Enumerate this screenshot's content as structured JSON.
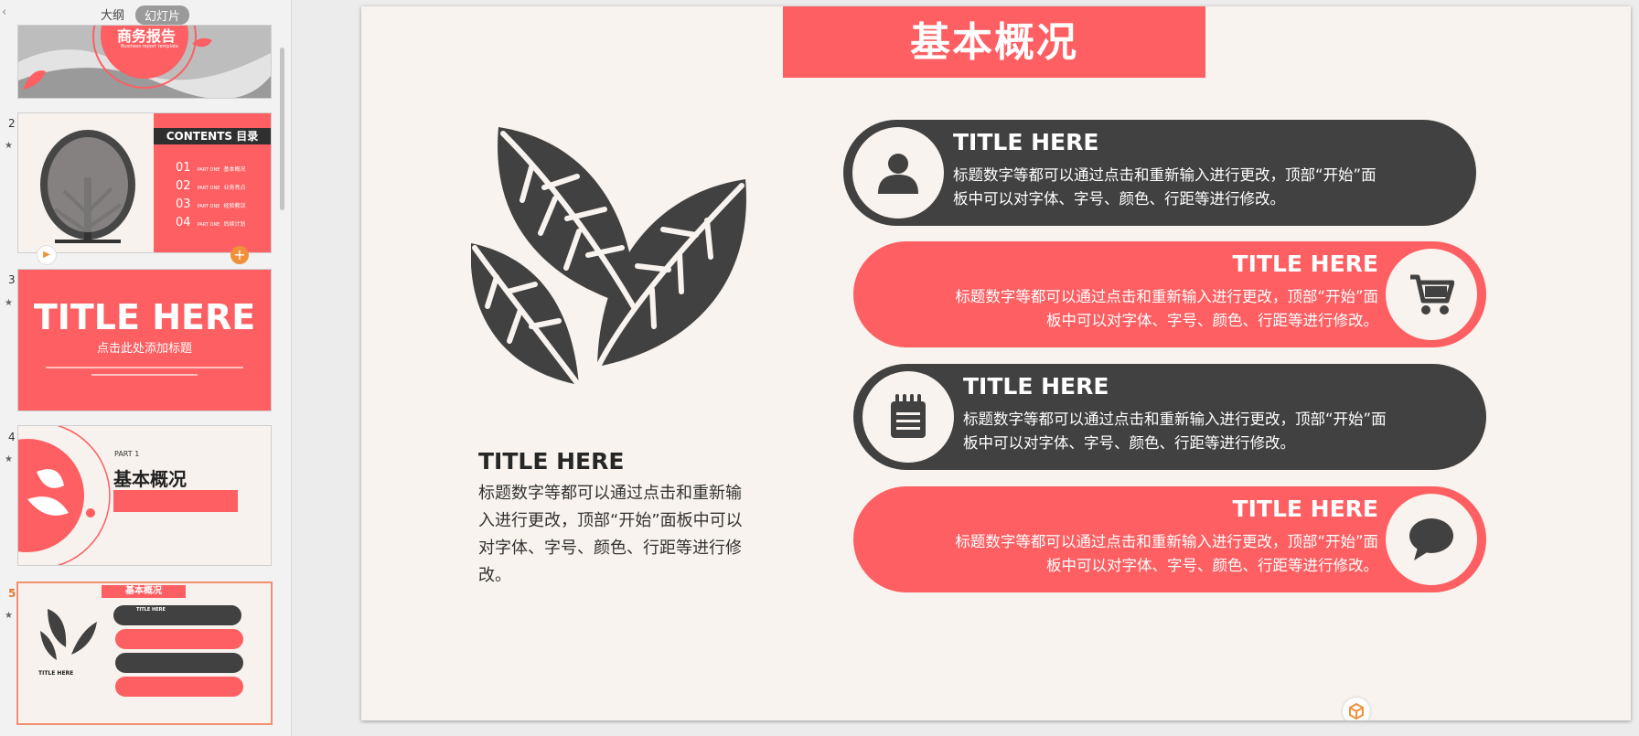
{
  "sidebar": {
    "tabs": {
      "outline": "大纲",
      "slides": "幻灯片"
    },
    "slides": [
      {
        "num": "",
        "title": "商务报告",
        "subtitle": "Business report template"
      },
      {
        "num": "2",
        "contents_title": "CONTENTS 目录",
        "items": [
          {
            "no": "01",
            "part": "PART ONE",
            "text": "基本概况"
          },
          {
            "no": "02",
            "part": "PART ONE",
            "text": "业务亮点"
          },
          {
            "no": "03",
            "part": "PART ONE",
            "text": "经验教训"
          },
          {
            "no": "04",
            "part": "PART ONE",
            "text": "后续计划"
          }
        ]
      },
      {
        "num": "3",
        "title": "TITLE HERE",
        "subtitle": "点击此处添加标题"
      },
      {
        "num": "4",
        "part": "PART 1",
        "title": "基本概况"
      },
      {
        "num": "5",
        "title": "基本概况",
        "left_title": "TITLE HERE",
        "card_title": "TITLE HERE"
      }
    ]
  },
  "slide": {
    "header": "基本概况",
    "left_title": "TITLE HERE",
    "left_desc": "标题数字等都可以通过点击和重新输入进行更改，顶部“开始”面板中可以对字体、字号、颜色、行距等进行修改。",
    "cards": [
      {
        "title": "TITLE HERE",
        "line1": "标题数字等都可以通过点击和重新输入进行更改，顶部“开始”面",
        "line2": "板中可以对字体、字号、颜色、行距等进行修改。",
        "icon": "person-icon"
      },
      {
        "title": "TITLE HERE",
        "line1": "标题数字等都可以通过点击和重新输入进行更改，顶部“开始”面",
        "line2": "板中可以对字体、字号、颜色、行距等进行修改。",
        "icon": "cart-icon"
      },
      {
        "title": "TITLE HERE",
        "line1": "标题数字等都可以通过点击和重新输入进行更改，顶部“开始”面",
        "line2": "板中可以对字体、字号、颜色、行距等进行修改。",
        "icon": "notepad-icon"
      },
      {
        "title": "TITLE HERE",
        "line1": "标题数字等都可以通过点击和重新输入进行更改，顶部“开始”面",
        "line2": "板中可以对字体、字号、颜色、行距等进行修改。",
        "icon": "chat-bubble-icon"
      }
    ]
  },
  "colors": {
    "accent": "#fd5f62",
    "dark": "#414141",
    "background": "#f8f3ee"
  }
}
